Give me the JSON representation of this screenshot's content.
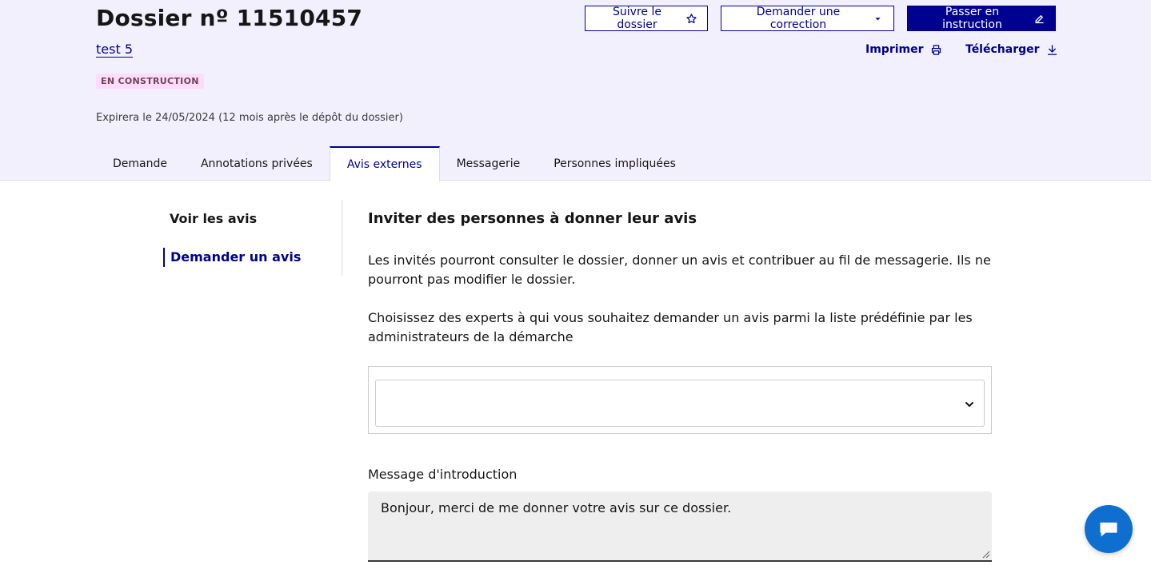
{
  "header": {
    "title": "Dossier nº 11510457",
    "subtitle_link": "test 5",
    "badge": "EN CONSTRUCTION",
    "expiry": "Expirera le 24/05/2024 (12 mois après le dépôt du dossier)"
  },
  "actions": {
    "follow": "Suivre le dossier",
    "request_correction": "Demander une correction",
    "start_instruction": "Passer en instruction",
    "print": "Imprimer",
    "download": "Télécharger"
  },
  "tabs": [
    {
      "label": "Demande"
    },
    {
      "label": "Annotations privées"
    },
    {
      "label": "Avis externes"
    },
    {
      "label": "Messagerie"
    },
    {
      "label": "Personnes impliquées"
    }
  ],
  "side_nav": [
    {
      "label": "Voir les avis"
    },
    {
      "label": "Demander un avis"
    }
  ],
  "main": {
    "heading": "Inviter des personnes à donner leur avis",
    "paragraph1": "Les invités pourront consulter le dossier, donner un avis et contribuer au fil de messagerie. Ils ne pourront pas modifier le dossier.",
    "paragraph2": "Choisissez des experts à qui vous souhaitez demander un avis parmi la liste prédéfinie par les administrateurs de la démarche",
    "select_value": "",
    "intro_label": "Message d'introduction",
    "intro_value": "Bonjour, merci de me donner votre avis sur ce dossier."
  },
  "colors": {
    "primary": "#000091",
    "header_bg": "#f3f0fd",
    "badge_bg": "#fddbfa",
    "chat_bg": "#0f6fd1"
  }
}
